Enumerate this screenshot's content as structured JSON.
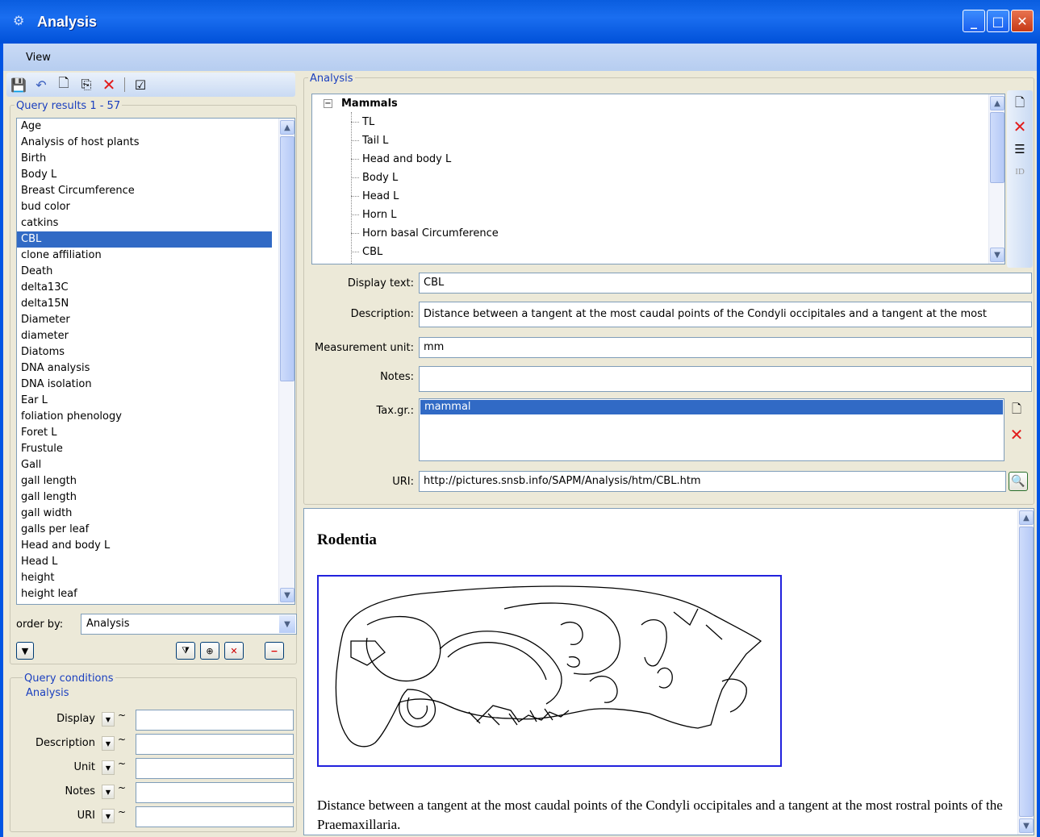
{
  "window": {
    "title": "Analysis"
  },
  "menu": {
    "view": "View"
  },
  "left": {
    "query_results_label": "Query results   1 - 57",
    "items": [
      "Age",
      "Analysis of host plants",
      "Birth",
      "Body L",
      "Breast Circumference",
      "bud color",
      "catkins",
      "CBL",
      "clone affiliation",
      "Death",
      "delta13C",
      "delta15N",
      "Diameter",
      "diameter",
      "Diatoms",
      "DNA analysis",
      "DNA isolation",
      "Ear L",
      "foliation phenology",
      "Foret L",
      "Frustule",
      "Gall",
      "gall length",
      "gall length",
      "gall width",
      "galls per leaf",
      "Head and body L",
      "Head L",
      "height",
      "height leaf"
    ],
    "selected_index": 7,
    "order_by_label": "order by:",
    "order_by_value": "Analysis",
    "query_conditions_label": "Query conditions",
    "analysis_group_label": "Analysis",
    "conditions": [
      {
        "label": "Display",
        "tilde": "~"
      },
      {
        "label": "Description",
        "tilde": "~"
      },
      {
        "label": "Unit",
        "tilde": "~"
      },
      {
        "label": "Notes",
        "tilde": "~"
      },
      {
        "label": "URI",
        "tilde": "~"
      }
    ]
  },
  "right": {
    "analysis_label": "Analysis",
    "tree": {
      "root": "Mammals",
      "children": [
        "TL",
        "Tail L",
        "Head and body L",
        "Body L",
        "Head L",
        "Horn L",
        "Horn basal Circumference",
        "CBL"
      ]
    },
    "display_text_label": "Display text:",
    "display_text": "CBL",
    "description_label": "Description:",
    "description": "Distance between a tangent at the most caudal points of the Condyli occipitales and a tangent at the most",
    "unit_label": "Measurement unit:",
    "unit": "mm",
    "notes_label": "Notes:",
    "notes": "",
    "taxgr_label": "Tax.gr.:",
    "taxgr": "mammal",
    "uri_label": "URI:",
    "uri": "http://pictures.snsb.info/SAPM/Analysis/htm/CBL.htm",
    "id_label": "ID"
  },
  "browser": {
    "heading": "Rodentia",
    "text": "Distance between a tangent at the most caudal points of the Condyli occipitales and a tangent at the most rostral points of the Praemaxillaria."
  },
  "colors": {
    "title_blue": "#0a5ddf",
    "selection": "#316ac5",
    "frame_blue": "#2222dd"
  }
}
